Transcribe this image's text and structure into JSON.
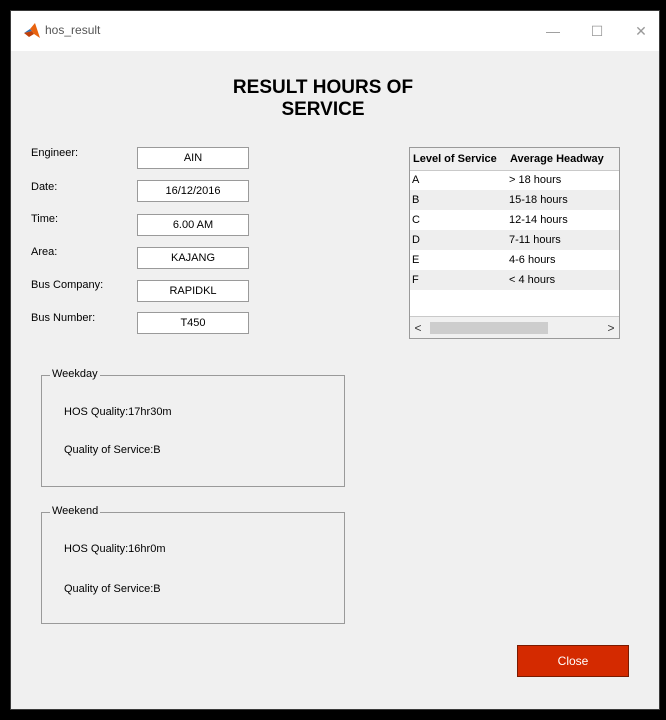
{
  "window": {
    "title": "hos_result",
    "minimize_glyph": "—",
    "maximize_glyph": "☐",
    "close_glyph": "✕"
  },
  "heading": {
    "line1": "RESULT HOURS OF",
    "line2": "SERVICE"
  },
  "form": {
    "engineer": {
      "label": "Engineer:",
      "value": "AIN"
    },
    "date": {
      "label": "Date:",
      "value": "16/12/2016"
    },
    "time": {
      "label": "Time:",
      "value": "6.00 AM"
    },
    "area": {
      "label": "Area:",
      "value": "KAJANG"
    },
    "bus_company": {
      "label": "Bus Company:",
      "value": "RAPIDKL"
    },
    "bus_number": {
      "label": "Bus Number:",
      "value": "T450"
    }
  },
  "weekday": {
    "title": "Weekday",
    "hos_quality": "HOS Quality:17hr30m",
    "quality_of_service": "Quality of Service:B"
  },
  "weekend": {
    "title": "Weekend",
    "hos_quality": "HOS Quality:16hr0m",
    "quality_of_service": "Quality of Service:B"
  },
  "table": {
    "headers": [
      "Level of Service",
      "Average Headway"
    ],
    "rows": [
      [
        "A",
        "> 18 hours"
      ],
      [
        "B",
        "15-18 hours"
      ],
      [
        "C",
        "12-14 hours"
      ],
      [
        "D",
        "7-11 hours"
      ],
      [
        "E",
        "4-6 hours"
      ],
      [
        "F",
        "< 4 hours"
      ]
    ],
    "scroll_left": "<",
    "scroll_right": ">"
  },
  "close_button": "Close",
  "colors": {
    "close_button_bg": "#d42a00",
    "window_bg": "#f0f0f0",
    "app_icon_orange": "#e8620e"
  }
}
